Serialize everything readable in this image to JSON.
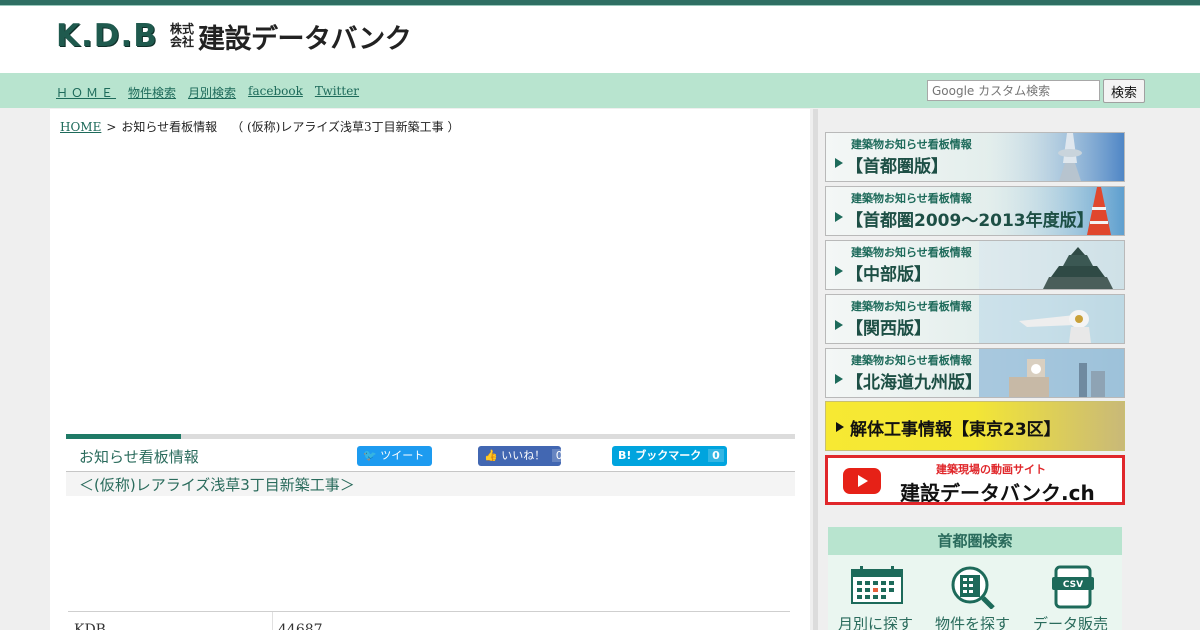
{
  "header": {
    "logo_mark": "K.D.B",
    "logo_kabu_1": "株式",
    "logo_kabu_2": "会社",
    "logo_name": "建設データバンク"
  },
  "nav": {
    "items": [
      "ＨＯＭＥ",
      "物件検索",
      "月別検索",
      "facebook",
      "Twitter"
    ]
  },
  "search": {
    "placeholder": "Google カスタム検索",
    "button_label": "検索"
  },
  "breadcrumb": {
    "home": "HOME",
    "separator": ">",
    "section": "お知らせ看板情報",
    "current": "（ (仮称)レアライズ浅草3丁目新築工事 ）"
  },
  "notice": {
    "title": "お知らせ看板情報",
    "tweet_label": "ツイート",
    "like_label": "いいね！",
    "like_count": "0",
    "bookmark_label": "B! ブックマーク",
    "bookmark_count": "0",
    "project_name": "＜(仮称)レアライズ浅草3丁目新築工事＞"
  },
  "table": {
    "rows": [
      {
        "label": "KDB",
        "value": "44687"
      }
    ]
  },
  "sidebar": {
    "banners": [
      {
        "sub": "建築物お知らせ看板情報",
        "main": "【首都圏版】"
      },
      {
        "sub": "建築物お知らせ看板情報",
        "main": "【首都圏2009〜2013年度版】"
      },
      {
        "sub": "建築物お知らせ看板情報",
        "main": "【中部版】"
      },
      {
        "sub": "建築物お知らせ看板情報",
        "main": "【関西版】"
      },
      {
        "sub": "建築物お知らせ看板情報",
        "main": "【北海道九州版】"
      }
    ],
    "demolition": "解体工事情報【東京23区】",
    "youtube_sub": "建築現場の動画サイト",
    "youtube_main": "建設データバンク.ch",
    "search_panel": {
      "title": "首都圏検索",
      "items": [
        "月別に探す",
        "物件を探す",
        "データ販売"
      ],
      "csv_icon_text": "CSV"
    }
  },
  "colors": {
    "brand_green": "#1d6a5a",
    "nav_bg": "#b8e4cf",
    "youtube_red": "#e0272b"
  }
}
